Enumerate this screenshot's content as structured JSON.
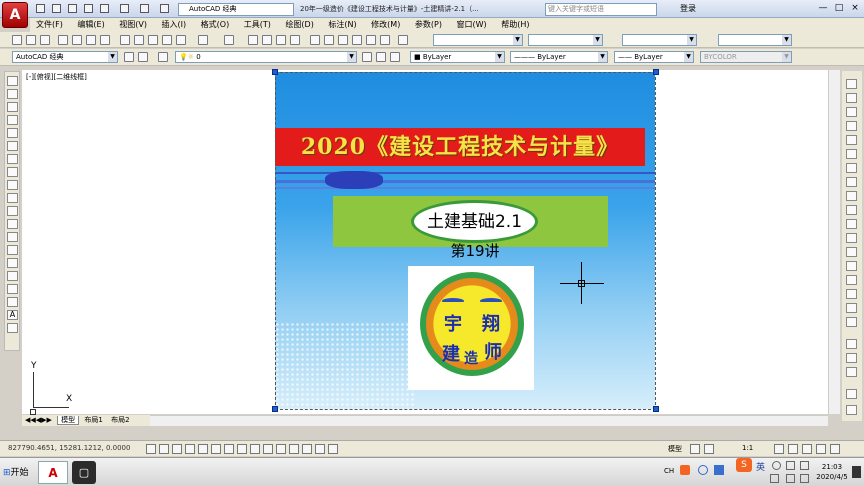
{
  "titlebar": {
    "logo_letter": "A",
    "workspace": "AutoCAD 经典",
    "title": "20年一级造价《建设工程技术与计量》-土建精讲-2.1（...",
    "search_placeholder": "键入关键字或短语",
    "login": "登录",
    "minimize": "—",
    "maximize": "□",
    "close": "×"
  },
  "menu": [
    "文件(F)",
    "编辑(E)",
    "视图(V)",
    "插入(I)",
    "格式(O)",
    "工具(T)",
    "绘图(D)",
    "标注(N)",
    "修改(M)",
    "参数(P)",
    "窗口(W)",
    "帮助(H)"
  ],
  "toolbar2": {
    "workspace_combo": "AutoCAD 经典",
    "layer_combo": "0",
    "color_combo": "ByLayer",
    "linetype_combo": "ByLayer",
    "lineweight_combo": "ByLayer",
    "plotstyle_combo": "BYCOLOR"
  },
  "viewport_label": "[-][俯视][二维线框]",
  "slide": {
    "title": "2020《建设工程技术与计量》",
    "subject": "土建基础2.1",
    "lecture": "第19讲",
    "logo_chars": [
      "宇",
      "翔",
      "建",
      "造",
      "师"
    ]
  },
  "ucs": {
    "x": "X",
    "y": "Y"
  },
  "tabs": [
    "模型",
    "布局1",
    "布局2"
  ],
  "status": {
    "coords": "827790.4651, 15281.1212, 0.0000",
    "model": "模型",
    "scale": "1:1"
  },
  "taskbar": {
    "start": "开始",
    "ime": "英",
    "lang": "CH",
    "time": "21:03",
    "date": "2020/4/5"
  }
}
